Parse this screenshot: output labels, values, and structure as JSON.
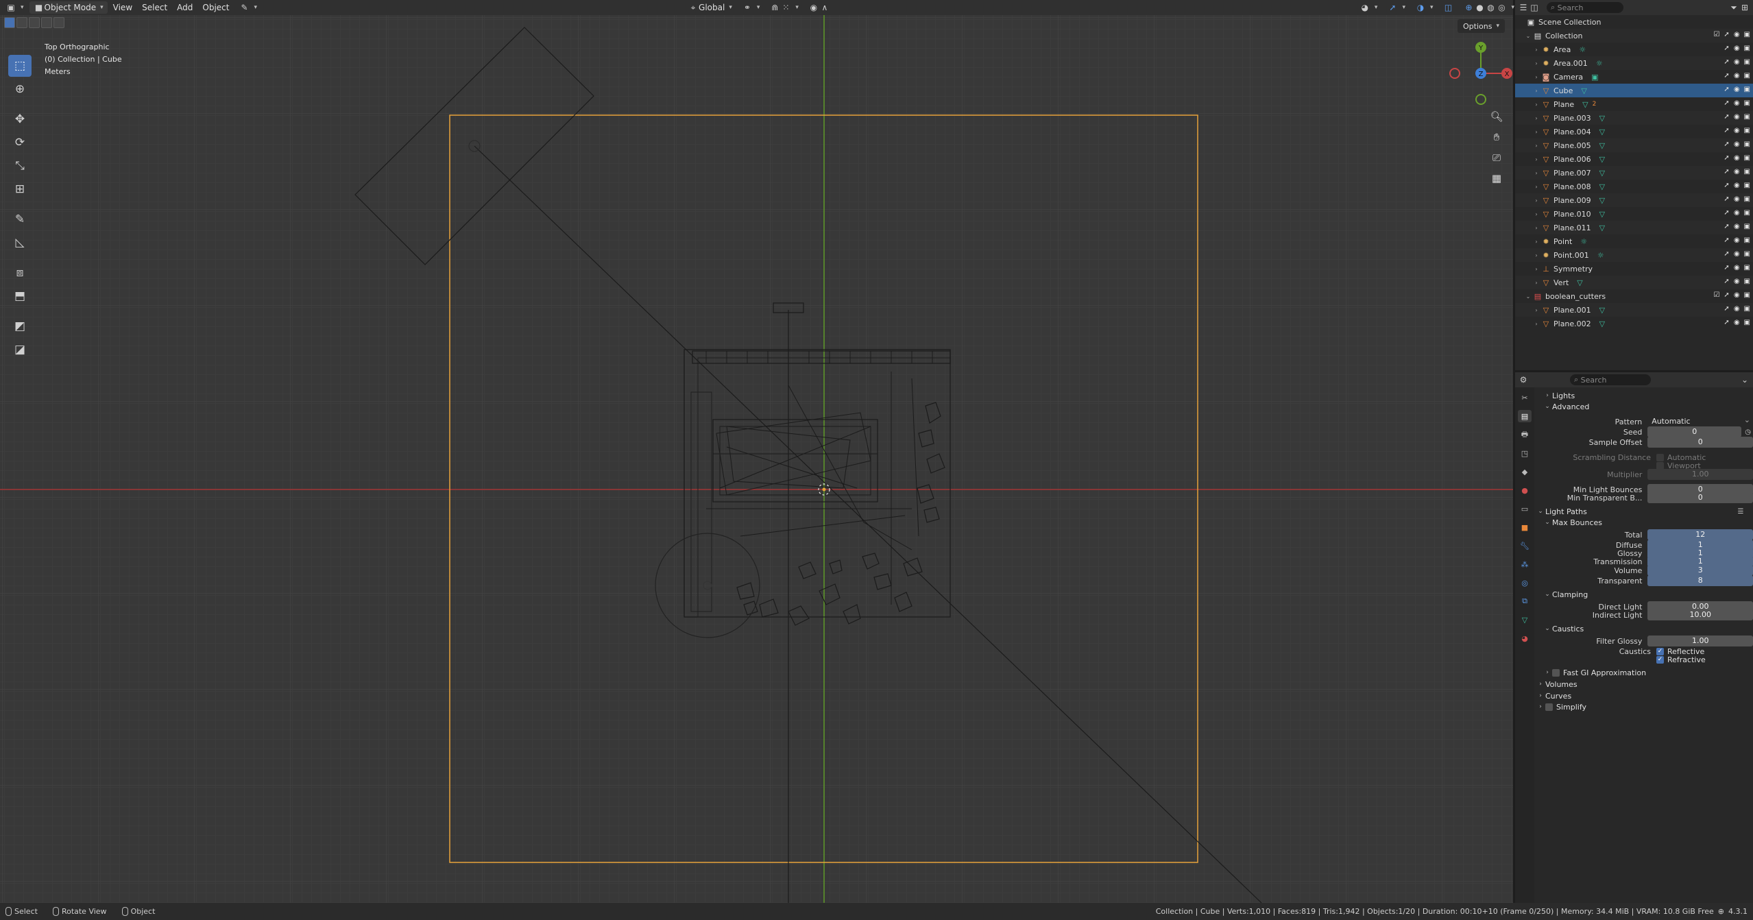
{
  "topbar": {
    "mode": "Object Mode",
    "menu": [
      "View",
      "Select",
      "Add",
      "Object"
    ],
    "orientation": "Global",
    "search_placeholder": "Search"
  },
  "viewport": {
    "info": [
      "Top Orthographic",
      "(0) Collection | Cube",
      "Meters"
    ],
    "options_label": "Options",
    "gizmo_axes": [
      "Y",
      "Z",
      "X"
    ]
  },
  "outliner": {
    "search_placeholder": "Search",
    "rows": [
      {
        "label": "Scene Collection",
        "kind": "scene"
      },
      {
        "label": "Collection",
        "kind": "collection"
      },
      {
        "label": "Area",
        "kind": "light"
      },
      {
        "label": "Area.001",
        "kind": "light"
      },
      {
        "label": "Camera",
        "kind": "camera"
      },
      {
        "label": "Cube",
        "kind": "mesh",
        "selected": true
      },
      {
        "label": "Plane",
        "kind": "mesh",
        "extra": "2"
      },
      {
        "label": "Plane.003",
        "kind": "mesh"
      },
      {
        "label": "Plane.004",
        "kind": "mesh"
      },
      {
        "label": "Plane.005",
        "kind": "mesh"
      },
      {
        "label": "Plane.006",
        "kind": "mesh"
      },
      {
        "label": "Plane.007",
        "kind": "mesh"
      },
      {
        "label": "Plane.008",
        "kind": "mesh"
      },
      {
        "label": "Plane.009",
        "kind": "mesh"
      },
      {
        "label": "Plane.010",
        "kind": "mesh"
      },
      {
        "label": "Plane.011",
        "kind": "mesh"
      },
      {
        "label": "Point",
        "kind": "light"
      },
      {
        "label": "Point.001",
        "kind": "light"
      },
      {
        "label": "Symmetry",
        "kind": "empty"
      },
      {
        "label": "Vert",
        "kind": "mesh"
      },
      {
        "label": "boolean_cutters",
        "kind": "collection-red"
      },
      {
        "label": "Plane.001",
        "kind": "mesh"
      },
      {
        "label": "Plane.002",
        "kind": "mesh"
      }
    ]
  },
  "properties": {
    "search_placeholder": "Search",
    "lights": "Lights",
    "advanced": "Advanced",
    "pattern_label": "Pattern",
    "pattern_value": "Automatic",
    "seed_label": "Seed",
    "seed_value": "0",
    "sample_offset_label": "Sample Offset",
    "sample_offset_value": "0",
    "scrambling_label": "Scrambling Distance",
    "scr_automatic": "Automatic",
    "scr_viewport": "Viewport",
    "multiplier_label": "Multiplier",
    "multiplier_value": "1.00",
    "min_light_bounces_label": "Min Light Bounces",
    "min_light_bounces_value": "0",
    "min_transparent_label": "Min Transparent B...",
    "min_transparent_value": "0",
    "light_paths": "Light Paths",
    "max_bounces": "Max Bounces",
    "total_label": "Total",
    "total_value": "12",
    "diffuse_label": "Diffuse",
    "diffuse_value": "1",
    "glossy_label": "Glossy",
    "glossy_value": "1",
    "transmission_label": "Transmission",
    "transmission_value": "1",
    "volume_label": "Volume",
    "volume_value": "3",
    "transparent_label": "Transparent",
    "transparent_value": "8",
    "clamping": "Clamping",
    "direct_light_label": "Direct Light",
    "direct_light_value": "0.00",
    "indirect_light_label": "Indirect Light",
    "indirect_light_value": "10.00",
    "caustics": "Caustics",
    "filter_glossy_label": "Filter Glossy",
    "filter_glossy_value": "1.00",
    "caustics_label": "Caustics",
    "reflective": "Reflective",
    "refractive": "Refractive",
    "fast_gi": "Fast GI Approximation",
    "volumes": "Volumes",
    "curves": "Curves",
    "simplify": "Simplify"
  },
  "statusbar": {
    "select": "Select",
    "rotate_view": "Rotate View",
    "object": "Object",
    "stats": "Collection | Cube | Verts:1,010 | Faces:819 | Tris:1,942 | Objects:1/20 | Duration: 00:10+10 (Frame 0/250) | Memory: 34.4 MiB | VRAM: 10.8 GiB Free",
    "version": "4.3.1"
  },
  "colors": {
    "accent": "#4772b3",
    "camera_frame": "#e8a33a",
    "x_axis": "#b23a3a",
    "y_axis": "#6aa02c"
  }
}
